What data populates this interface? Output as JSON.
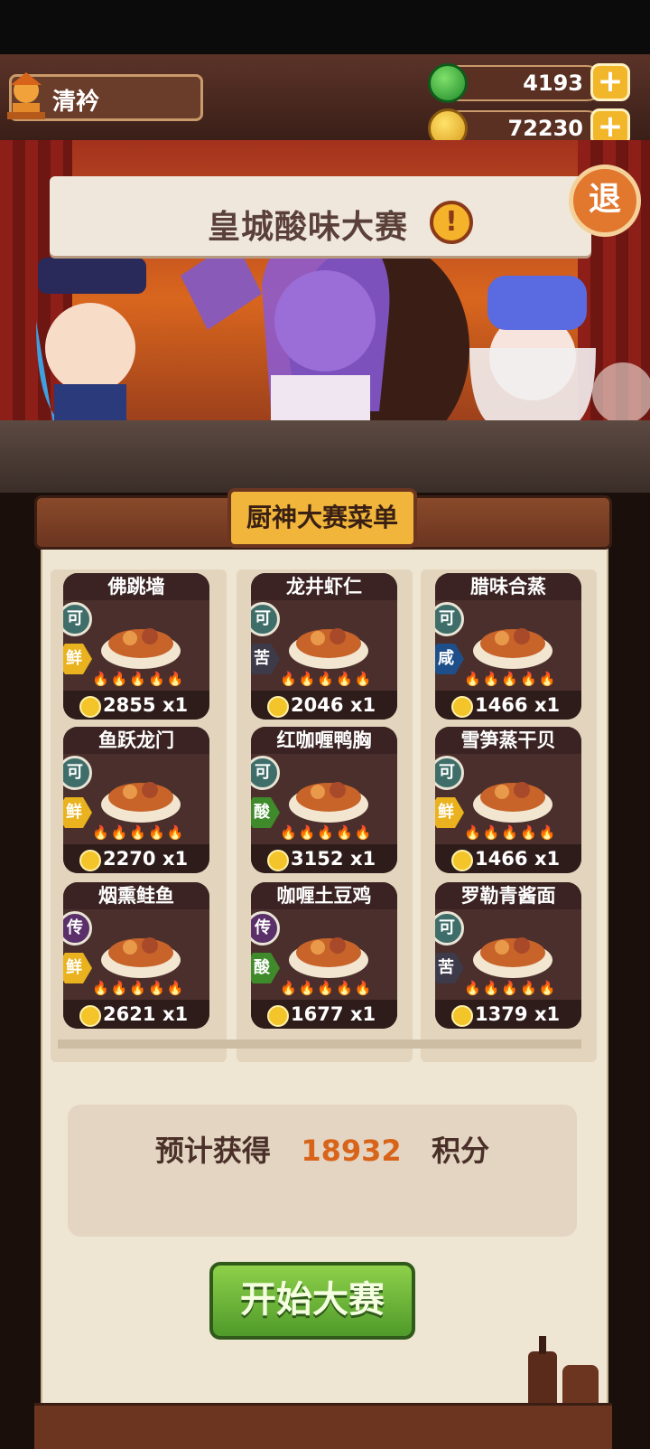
{
  "player": {
    "name": "清衿"
  },
  "resources": {
    "jade": "4193",
    "coins": "72230"
  },
  "event": {
    "title": "皇城酸味大赛",
    "alert_symbol": "!",
    "exit_label": "退"
  },
  "menu": {
    "title": "厨神大赛菜单",
    "dishes": [
      {
        "name": "佛跳墙",
        "badge": "可",
        "taste": "鲜",
        "price": "2855",
        "qty": "x1",
        "taste_color": "#e9b21e",
        "badge_color": "#3f6e6a"
      },
      {
        "name": "龙井虾仁",
        "badge": "可",
        "taste": "苦",
        "price": "2046",
        "qty": "x1",
        "taste_color": "#3d3a4a",
        "badge_color": "#3f6e6a"
      },
      {
        "name": "腊味合蒸",
        "badge": "可",
        "taste": "咸",
        "price": "1466",
        "qty": "x1",
        "taste_color": "#1f4f8a",
        "badge_color": "#3f6e6a"
      },
      {
        "name": "鱼跃龙门",
        "badge": "可",
        "taste": "鲜",
        "price": "2270",
        "qty": "x1",
        "taste_color": "#e9b21e",
        "badge_color": "#3f6e6a"
      },
      {
        "name": "红咖喱鸭胸",
        "badge": "可",
        "taste": "酸",
        "price": "3152",
        "qty": "x1",
        "taste_color": "#3f8a2a",
        "badge_color": "#3f6e6a"
      },
      {
        "name": "雪笋蒸干贝",
        "badge": "可",
        "taste": "鲜",
        "price": "1466",
        "qty": "x1",
        "taste_color": "#e9b21e",
        "badge_color": "#3f6e6a"
      },
      {
        "name": "烟熏鲑鱼",
        "badge": "传",
        "taste": "鲜",
        "price": "2621",
        "qty": "x1",
        "taste_color": "#e9b21e",
        "badge_color": "#5a2f6a"
      },
      {
        "name": "咖喱土豆鸡",
        "badge": "传",
        "taste": "酸",
        "price": "1677",
        "qty": "x1",
        "taste_color": "#3f8a2a",
        "badge_color": "#5a2f6a"
      },
      {
        "name": "罗勒青酱面",
        "badge": "可",
        "taste": "苦",
        "price": "1379",
        "qty": "x1",
        "taste_color": "#3d3a4a",
        "badge_color": "#3f6e6a"
      }
    ]
  },
  "estimate": {
    "prefix": "预计获得",
    "value": "18932",
    "suffix": "积分"
  },
  "start_button": {
    "label": "开始大赛"
  }
}
